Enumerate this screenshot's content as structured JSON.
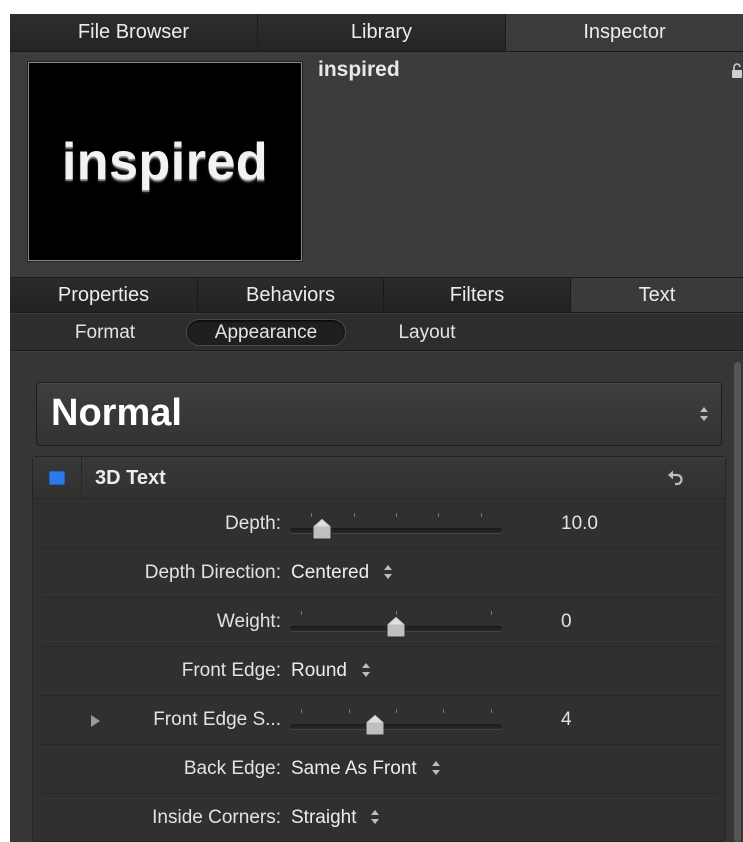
{
  "top_tabs": [
    "File Browser",
    "Library",
    "Inspector"
  ],
  "header": {
    "preview_text": "inspired",
    "item_name": "inspired"
  },
  "inspector_tabs": [
    "Properties",
    "Behaviors",
    "Filters",
    "Text"
  ],
  "sub_tabs": [
    "Format",
    "Appearance",
    "Layout"
  ],
  "preset": {
    "value": "Normal"
  },
  "group": {
    "title": "3D Text",
    "enabled": true,
    "checkbox_color": "#2f7ae8",
    "rows": {
      "depth": {
        "label": "Depth:",
        "value": "10.0",
        "slider_fraction": 0.15
      },
      "depth_direction": {
        "label": "Depth Direction:",
        "value": "Centered"
      },
      "weight": {
        "label": "Weight:",
        "value": "0",
        "slider_fraction": 0.5
      },
      "front_edge": {
        "label": "Front Edge:",
        "value": "Round"
      },
      "front_edge_size": {
        "label": "Front Edge S...",
        "value": "4",
        "slider_fraction": 0.4
      },
      "back_edge": {
        "label": "Back Edge:",
        "value": "Same As Front"
      },
      "inside_corners": {
        "label": "Inside Corners:",
        "value": "Straight"
      }
    }
  }
}
